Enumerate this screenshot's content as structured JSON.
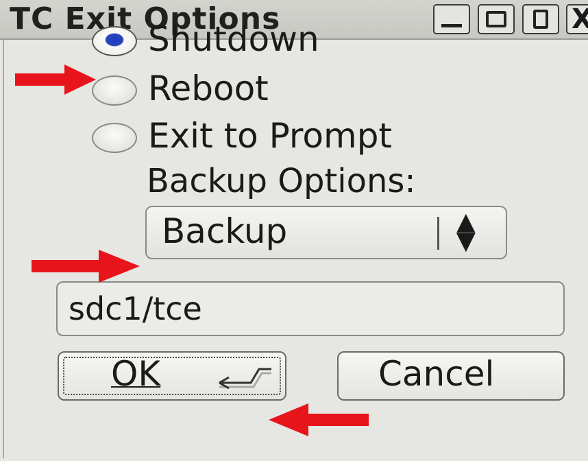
{
  "window": {
    "title": "TC Exit Options",
    "controls": {
      "minimize": "_",
      "close": "X"
    }
  },
  "options": [
    {
      "label": "Shutdown",
      "checked": true
    },
    {
      "label": "Reboot",
      "checked": false
    },
    {
      "label": "Exit to Prompt",
      "checked": false
    }
  ],
  "backup": {
    "label": "Backup Options:",
    "selected": "Backup"
  },
  "path_field": {
    "value": "sdc1/tce"
  },
  "buttons": {
    "ok": "OK",
    "cancel": "Cancel"
  },
  "annotation_color": "#e8141c"
}
